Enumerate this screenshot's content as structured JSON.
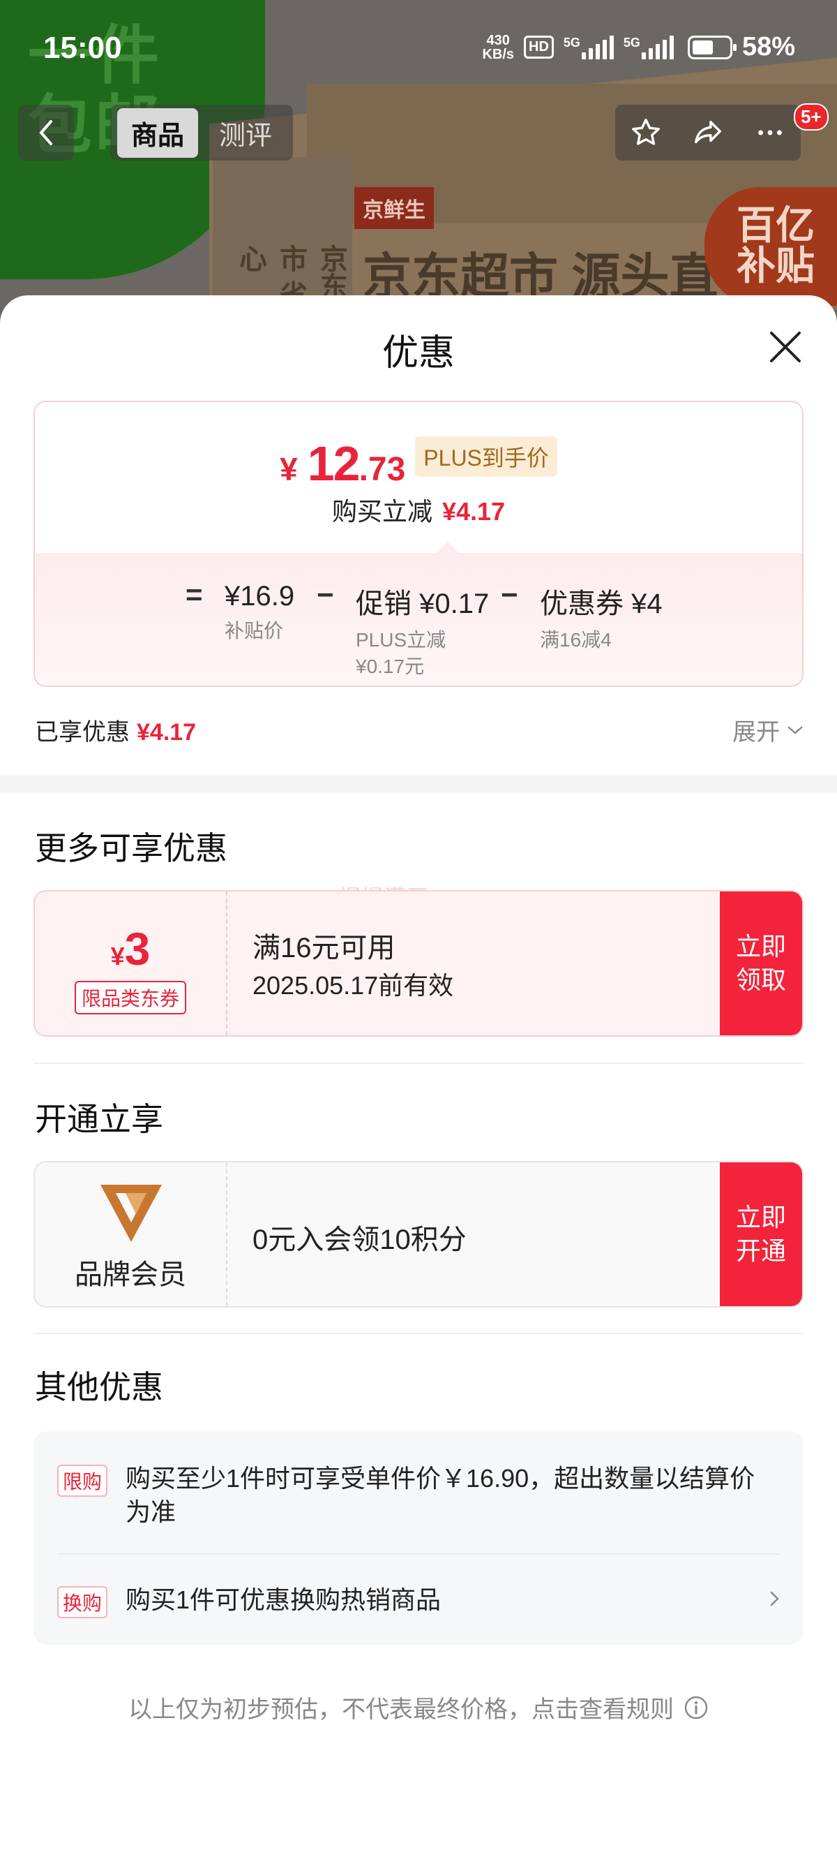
{
  "status_bar": {
    "time": "15:00",
    "net_speed_value": "430",
    "net_speed_unit": "KB/s",
    "hd_label": "HD",
    "sim1_label": "5G",
    "sim2_label": "5G",
    "battery_percent": "58%",
    "battery_level": 0.58
  },
  "product_bg": {
    "top_left_text": "一件包邮",
    "box_label": "京鲜生",
    "box_text": "京东超市 源头直",
    "side_text": "京东超市 省心",
    "badge_text_line1": "百亿",
    "badge_text_line2": "补贴"
  },
  "nav": {
    "tabs": [
      "商品",
      "测评"
    ],
    "more_badge": "5+"
  },
  "sheet": {
    "title": "优惠",
    "price": {
      "currency": "¥",
      "integer": "12",
      "decimal": ".73",
      "tag": "PLUS到手价",
      "sub_label": "购买立减",
      "sub_value": "¥4.17"
    },
    "calc": {
      "equals": "=",
      "minus": "−",
      "base_value": "¥16.9",
      "base_label": "补贴价",
      "promo_value": "促销 ¥0.17",
      "promo_label_1": "PLUS立减",
      "promo_label_2": "¥0.17元",
      "coupon_value": "优惠券 ¥4",
      "coupon_label": "满16减4"
    },
    "enjoyed_label": "已享优惠",
    "enjoyed_value": "¥4.17",
    "expand_label": "展开"
  },
  "more_offers": {
    "title": "更多可享优惠",
    "watermark": "慢慢满买",
    "coupon": {
      "currency": "¥",
      "amount": "3",
      "label": "限品类东券",
      "condition": "满16元可用",
      "valid_until": "2025.05.17前有效",
      "button_line1": "立即",
      "button_line2": "领取"
    }
  },
  "membership": {
    "title": "开通立享",
    "brand_label": "品牌会员",
    "desc": "0元入会领10积分",
    "button_line1": "立即",
    "button_line2": "开通"
  },
  "other_offers": {
    "title": "其他优惠",
    "items": [
      {
        "tag": "限购",
        "text": "购买至少1件时可享受单件价￥16.90，超出数量以结算价为准"
      },
      {
        "tag": "换购",
        "text": "购买1件可优惠换购热销商品"
      }
    ]
  },
  "footer": {
    "text": "以上仅为初步预估，不代表最终价格，点击查看规则"
  },
  "colors": {
    "accent_red": "#e8243b",
    "button_red": "#f2233a",
    "plus_gold": "#a0691a",
    "member_logo": "#c8772e"
  }
}
